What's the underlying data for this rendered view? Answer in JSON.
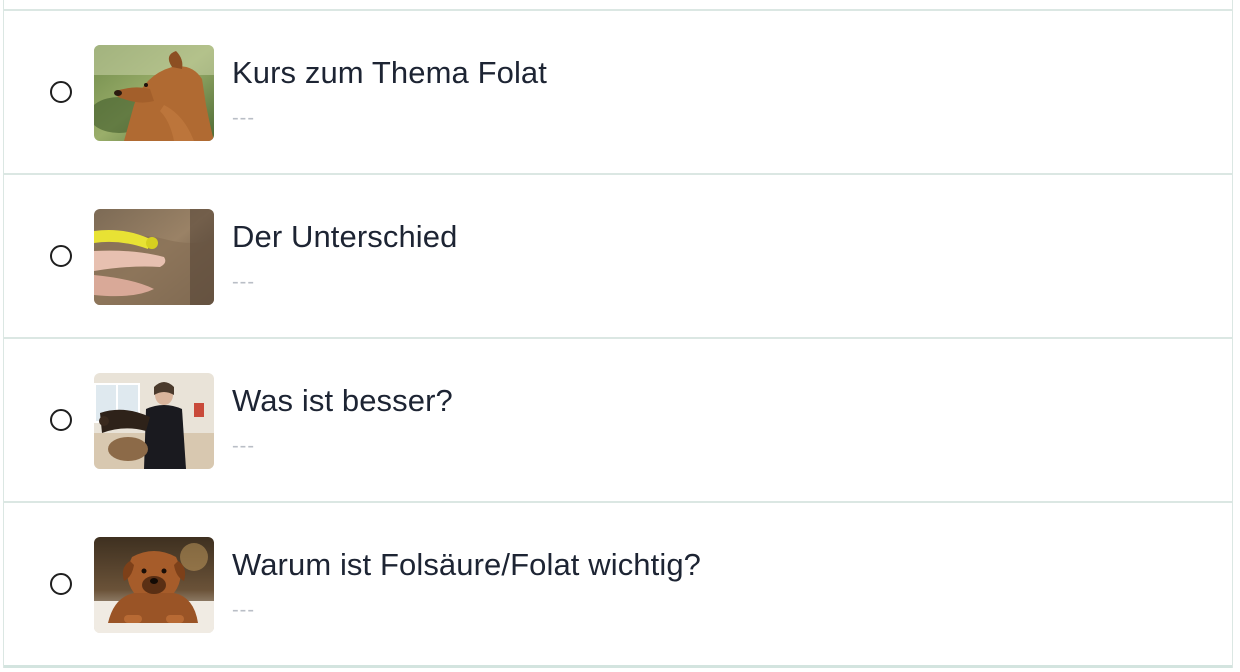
{
  "lessons": [
    {
      "title": "Kurs zum Thema Folat",
      "subtitle": "---",
      "thumbnail": "dog-portrait-thumbnail"
    },
    {
      "title": "Der Unterschied",
      "subtitle": "---",
      "thumbnail": "dog-collar-closeup-thumbnail"
    },
    {
      "title": "Was ist besser?",
      "subtitle": "---",
      "thumbnail": "woman-with-dogs-thumbnail"
    },
    {
      "title": "Warum ist Folsäure/Folat wichtig?",
      "subtitle": "---",
      "thumbnail": "puppy-lying-thumbnail"
    }
  ],
  "colors": {
    "border": "#dbe7e3",
    "title_text": "#1d2433",
    "subtitle_text": "#b9bec6",
    "radio_border": "#1f1f1f"
  }
}
